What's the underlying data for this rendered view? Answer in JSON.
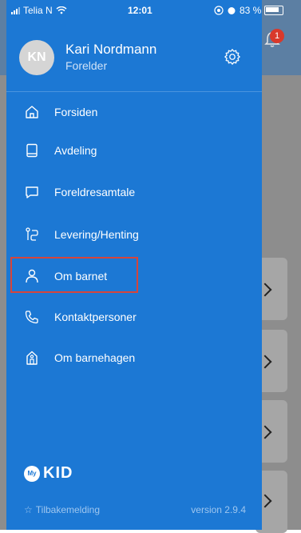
{
  "status_bar": {
    "carrier": "Telia N",
    "time": "12:01",
    "battery": "83 %"
  },
  "notification_badge": "1",
  "profile": {
    "initials": "KN",
    "name": "Kari Nordmann",
    "role": "Forelder"
  },
  "menu": {
    "items": [
      {
        "label": "Forsiden",
        "icon": "home-icon"
      },
      {
        "label": "Avdeling",
        "icon": "book-icon"
      },
      {
        "label": "Foreldresamtale",
        "icon": "chat-icon"
      },
      {
        "label": "Levering/Henting",
        "icon": "route-icon"
      },
      {
        "label": "Om barnet",
        "icon": "person-icon"
      },
      {
        "label": "Kontaktpersoner",
        "icon": "phone-icon"
      },
      {
        "label": "Om barnehagen",
        "icon": "building-icon"
      }
    ],
    "highlighted_index": 4
  },
  "logo": {
    "mark_text": "My",
    "word": "KID"
  },
  "footer": {
    "feedback": "Tilbakemelding",
    "version": "version 2.9.4"
  },
  "colors": {
    "drawer": "#1c78d4",
    "highlight_border": "#d6453b",
    "overlay": "#8d8d8d"
  }
}
